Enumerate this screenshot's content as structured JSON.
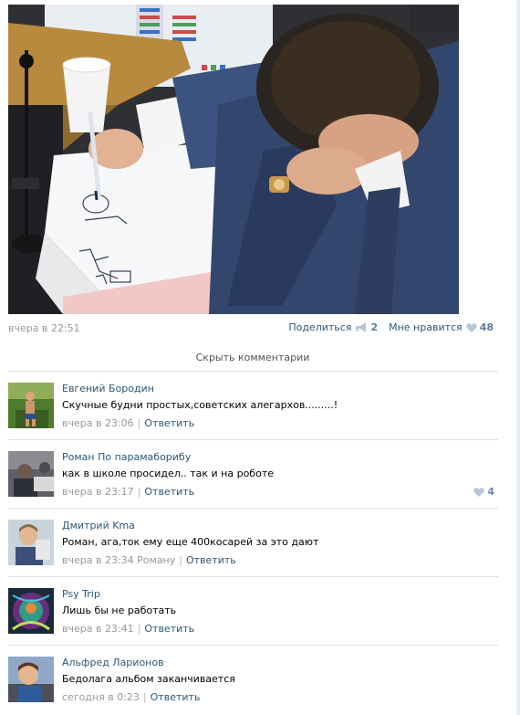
{
  "post": {
    "date": "вчера в 22:51",
    "share_label": "Поделиться",
    "share_count": "2",
    "like_label": "Мне нравится",
    "like_count": "48",
    "hide_comments_label": "Скрыть комментарии"
  },
  "comments": [
    {
      "author": "Евгений Бородин",
      "text": "Скучные будни простых,советских алегархов.........!",
      "time": "вчера в 23:06",
      "reply_to": "",
      "reply_label": "Ответить",
      "likes": ""
    },
    {
      "author": "Роман По парамаборибу",
      "text": "как в школе просидел.. так и на роботе",
      "time": "вчера в 23:17",
      "reply_to": "",
      "reply_label": "Ответить",
      "likes": "4"
    },
    {
      "author": "Дмитрий Kma",
      "text": "Роман, ага,ток ему еще 400косарей за это дают",
      "time": "вчера в 23:34",
      "reply_to": "Роману",
      "reply_label": "Ответить",
      "likes": ""
    },
    {
      "author": "Psy Trip",
      "text": "Лишь бы не работать",
      "time": "вчера в 23:41",
      "reply_to": "",
      "reply_label": "Ответить",
      "likes": ""
    },
    {
      "author": "Альфред Ларионов",
      "text": "Бедолага альбом заканчивается",
      "time": "сегодня в 0:23",
      "reply_to": "",
      "reply_label": "Ответить",
      "likes": ""
    }
  ],
  "icons": {
    "share": "megaphone-icon",
    "like": "heart-icon"
  },
  "colors": {
    "link": "#2b587a",
    "muted": "#999999",
    "separator": "#dbe2ea",
    "like_heart": "#b6c6d7"
  }
}
